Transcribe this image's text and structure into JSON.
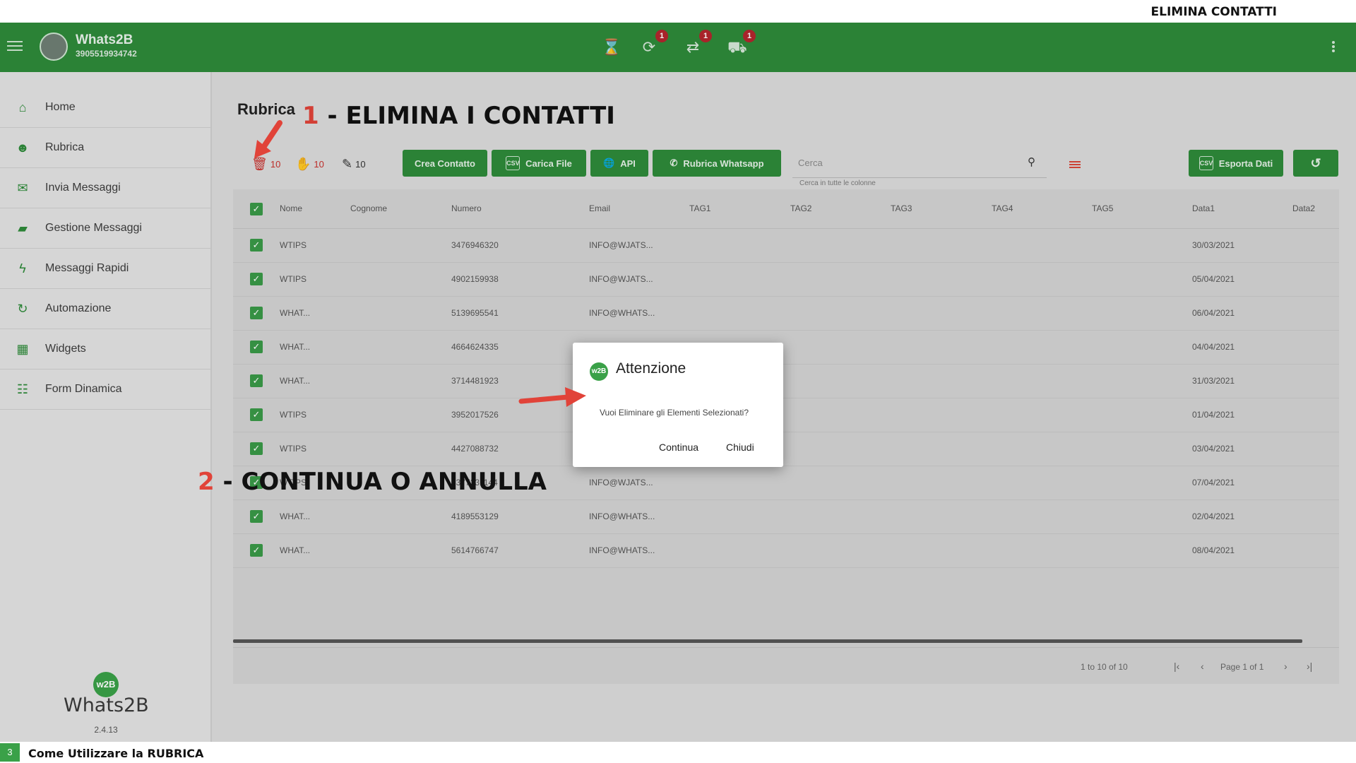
{
  "banner": {
    "title": "ELIMINA CONTATTI"
  },
  "header": {
    "app_name": "Whats2B",
    "phone": "3905519934742",
    "badges": [
      "1",
      "1",
      "1"
    ]
  },
  "sidebar": {
    "items": [
      {
        "label": "Home",
        "icon": "home-icon"
      },
      {
        "label": "Rubrica",
        "icon": "contacts-icon"
      },
      {
        "label": "Invia Messaggi",
        "icon": "mail-icon"
      },
      {
        "label": "Gestione Messaggi",
        "icon": "folder-icon"
      },
      {
        "label": "Messaggi Rapidi",
        "icon": "bolt-icon"
      },
      {
        "label": "Automazione",
        "icon": "sync-icon"
      },
      {
        "label": "Widgets",
        "icon": "widgets-icon"
      },
      {
        "label": "Form Dinamica",
        "icon": "form-icon"
      }
    ],
    "logo_badge": "w2B",
    "logo_word": "Whats2B",
    "version": "2.4.13"
  },
  "main": {
    "title": "Rubrica",
    "annotation1_num": "1",
    "annotation1_text": " - ELIMINA I CONTATTI",
    "annotation2_num": "2",
    "annotation2_text": " - CONTINUA O ANNULLA",
    "counters": {
      "delete": "10",
      "block": "10",
      "edit": "10"
    },
    "buttons": {
      "crea": "Crea Contatto",
      "carica": "Carica File",
      "api": "API",
      "rubrica_wa": "Rubrica Whatsapp",
      "esporta": "Esporta Dati",
      "csv": "CSV"
    },
    "search": {
      "placeholder": "Cerca",
      "hint": "Cerca in tutte le colonne"
    }
  },
  "table": {
    "columns": [
      "Nome",
      "Cognome",
      "Numero",
      "Email",
      "TAG1",
      "TAG2",
      "TAG3",
      "TAG4",
      "TAG5",
      "Data1",
      "Data2"
    ],
    "rows": [
      {
        "nome": "WTIPS",
        "numero": "3476946320",
        "email": "INFO@WJATS...",
        "data1": "30/03/2021"
      },
      {
        "nome": "WTIPS",
        "numero": "4902159938",
        "email": "INFO@WJATS...",
        "data1": "05/04/2021"
      },
      {
        "nome": "WHAT...",
        "numero": "5139695541",
        "email": "INFO@WHATS...",
        "data1": "06/04/2021"
      },
      {
        "nome": "WHAT...",
        "numero": "4664624335",
        "email": "",
        "data1": "04/04/2021"
      },
      {
        "nome": "WHAT...",
        "numero": "3714481923",
        "email": "",
        "data1": "31/03/2021"
      },
      {
        "nome": "WTIPS",
        "numero": "3952017526",
        "email": "",
        "data1": "01/04/2021"
      },
      {
        "nome": "WTIPS",
        "numero": "4427088732",
        "email": "INFO@WJATS...",
        "data1": "03/04/2021"
      },
      {
        "nome": "WTIPS",
        "numero": "5377231144",
        "email": "INFO@WJATS...",
        "data1": "07/04/2021"
      },
      {
        "nome": "WHAT...",
        "numero": "4189553129",
        "email": "INFO@WHATS...",
        "data1": "02/04/2021"
      },
      {
        "nome": "WHAT...",
        "numero": "5614766747",
        "email": "INFO@WHATS...",
        "data1": "08/04/2021"
      }
    ],
    "pager": {
      "info": "1 to 10 of 10",
      "page": "Page 1 of 1"
    }
  },
  "dialog": {
    "logo": "w2B",
    "title": "Attenzione",
    "message": "Vuoi Eliminare gli Elementi Selezionati?",
    "continue": "Continua",
    "close": "Chiudi"
  },
  "footer": {
    "step": "3",
    "title": "Come Utilizzare la RUBRICA"
  },
  "colors": {
    "brand": "#2e8b3a",
    "accent_red": "#e14339"
  }
}
